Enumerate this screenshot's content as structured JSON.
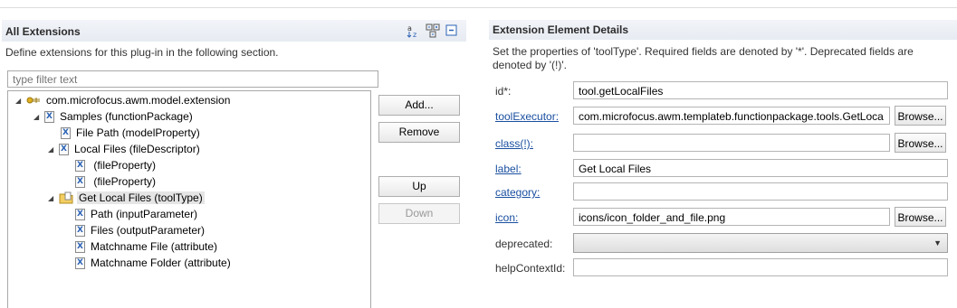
{
  "left": {
    "title": "All Extensions",
    "description": "Define extensions for this plug-in in the following section.",
    "filter_placeholder": "type filter text",
    "tree": [
      {
        "label": "com.microfocus.awm.model.extension"
      },
      {
        "label": "Samples (functionPackage)"
      },
      {
        "label": "File Path (modelProperty)"
      },
      {
        "label": "Local Files (fileDescriptor)"
      },
      {
        "label": " (fileProperty)"
      },
      {
        "label": " (fileProperty)"
      },
      {
        "label": "Get Local Files (toolType)"
      },
      {
        "label": "Path (inputParameter)"
      },
      {
        "label": "Files (outputParameter)"
      },
      {
        "label": "Matchname File (attribute)"
      },
      {
        "label": "Matchname Folder (attribute)"
      }
    ],
    "buttons": {
      "add": "Add...",
      "remove": "Remove",
      "up": "Up",
      "down": "Down"
    }
  },
  "right": {
    "title": "Extension Element Details",
    "description": "Set the properties of 'toolType'. Required fields are denoted by '*'. Deprecated fields are denoted by '(!)'.",
    "fields": {
      "id": {
        "label": "id*:",
        "value": "tool.getLocalFiles"
      },
      "toolExecutor": {
        "label": "toolExecutor:",
        "value": "com.microfocus.awm.templateb.functionpackage.tools.GetLoca"
      },
      "class": {
        "label": "class(!):",
        "value": ""
      },
      "label": {
        "label": "label:",
        "value": "Get Local Files"
      },
      "category": {
        "label": "category:",
        "value": ""
      },
      "icon": {
        "label": "icon:",
        "value": "icons/icon_folder_and_file.png"
      },
      "deprecated": {
        "label": "deprecated:",
        "value": ""
      },
      "helpContextId": {
        "label": "helpContextId:",
        "value": ""
      }
    },
    "browse_label": "Browse..."
  }
}
